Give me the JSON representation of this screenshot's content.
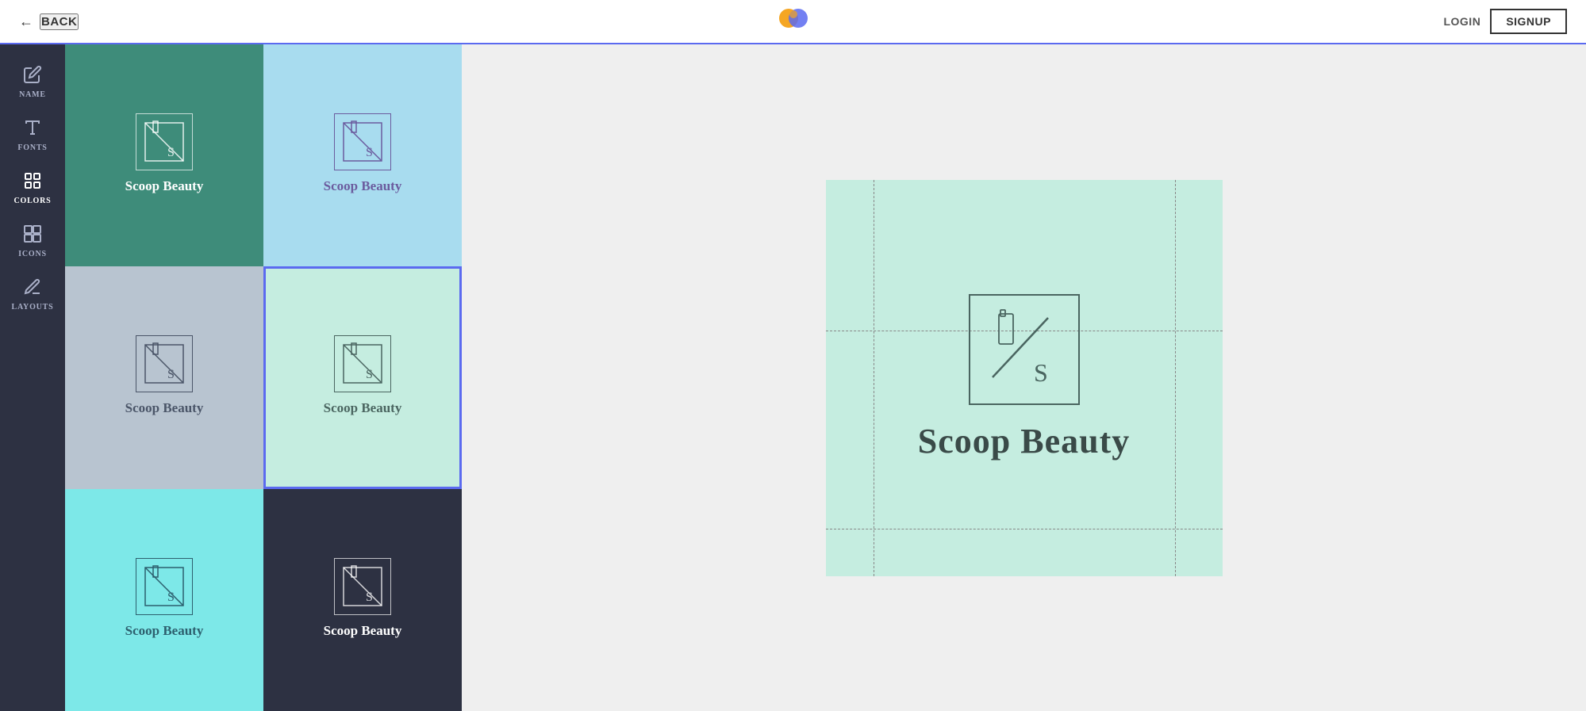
{
  "topnav": {
    "back_label": "BACK",
    "login_label": "LOGIN",
    "signup_label": "SIGNUP"
  },
  "sidebar": {
    "items": [
      {
        "id": "name",
        "label": "NAME",
        "icon": "✏️"
      },
      {
        "id": "fonts",
        "label": "FONTS",
        "icon": "𝐴"
      },
      {
        "id": "colors",
        "label": "COLORS",
        "icon": "🎨",
        "active": true
      },
      {
        "id": "icons",
        "label": "ICONS",
        "icon": "◈"
      },
      {
        "id": "layouts",
        "label": "LAYOUTS",
        "icon": "✒️"
      }
    ]
  },
  "thumbnails": [
    {
      "id": "card-1",
      "bg": "green-dark",
      "title": "Scoop Beauty",
      "selected": false
    },
    {
      "id": "card-2",
      "bg": "blue-light",
      "title": "Scoop Beauty",
      "selected": false
    },
    {
      "id": "card-3",
      "bg": "gray-light",
      "title": "Scoop Beauty",
      "selected": false
    },
    {
      "id": "card-4",
      "bg": "mint",
      "title": "Scoop Beauty",
      "selected": true
    },
    {
      "id": "card-5",
      "bg": "cyan",
      "title": "Scoop Beauty",
      "selected": false
    },
    {
      "id": "card-6",
      "bg": "dark",
      "title": "Scoop Beauty",
      "selected": false
    }
  ],
  "preview": {
    "brand_name": "Scoop Beauty"
  }
}
